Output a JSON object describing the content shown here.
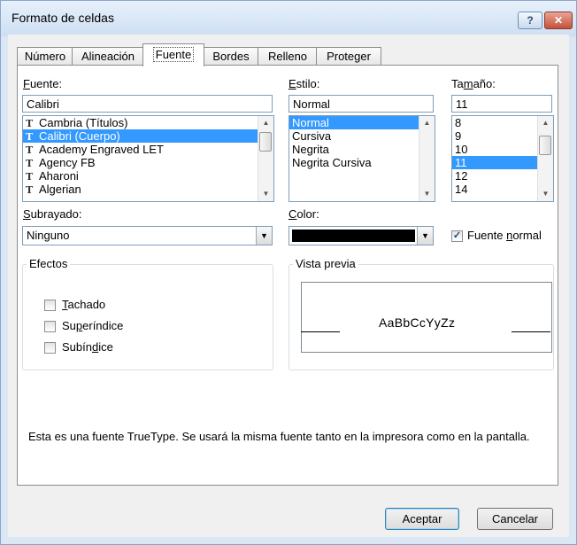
{
  "window": {
    "title": "Formato de celdas",
    "help_label": "?",
    "close_label": "✕"
  },
  "tabs": [
    {
      "label": "Número"
    },
    {
      "label": "Alineación"
    },
    {
      "label": "Fuente"
    },
    {
      "label": "Bordes"
    },
    {
      "label": "Relleno"
    },
    {
      "label": "Proteger"
    }
  ],
  "active_tab": "Fuente",
  "font": {
    "label_pre": "",
    "label_key": "F",
    "label_post": "uente:",
    "value": "Calibri",
    "items": [
      "Cambria (Títulos)",
      "Calibri (Cuerpo)",
      "Academy Engraved LET",
      "Agency FB",
      "Aharoni",
      "Algerian"
    ],
    "selected": "Calibri (Cuerpo)",
    "item_icon": "truetype-icon"
  },
  "style": {
    "label_pre": "",
    "label_key": "E",
    "label_post": "stilo:",
    "value": "Normal",
    "items": [
      "Normal",
      "Cursiva",
      "Negrita",
      "Negrita Cursiva"
    ],
    "selected": "Normal"
  },
  "size": {
    "label_pre": "Ta",
    "label_key": "m",
    "label_post": "año:",
    "value": "11",
    "items": [
      "8",
      "9",
      "10",
      "11",
      "12",
      "14"
    ],
    "selected": "11"
  },
  "underline": {
    "label_pre": "",
    "label_key": "S",
    "label_post": "ubrayado:",
    "value": "Ninguno"
  },
  "color": {
    "label_pre": "",
    "label_key": "C",
    "label_post": "olor:",
    "value_color": "#000000"
  },
  "normal_font": {
    "label_pre": "Fuente ",
    "label_key": "n",
    "label_post": "ormal",
    "checked": true
  },
  "effects": {
    "title": "Efectos",
    "items": [
      {
        "label_pre": "",
        "label_key": "T",
        "label_post": "achado",
        "checked": false
      },
      {
        "label_pre": "Su",
        "label_key": "p",
        "label_post": "eríndice",
        "checked": false
      },
      {
        "label_pre": "Subín",
        "label_key": "d",
        "label_post": "ice",
        "checked": false
      }
    ]
  },
  "preview": {
    "title": "Vista previa",
    "sample": "AaBbCcYyZz"
  },
  "info_text": "Esta es una fuente TrueType. Se usará la misma fuente tanto en la impresora como en la pantalla.",
  "buttons": {
    "ok": "Aceptar",
    "cancel": "Cancelar"
  },
  "colors": {
    "selection": "#3399ff",
    "titlebar": "#cfe0f3",
    "close_button": "#c4513b"
  }
}
